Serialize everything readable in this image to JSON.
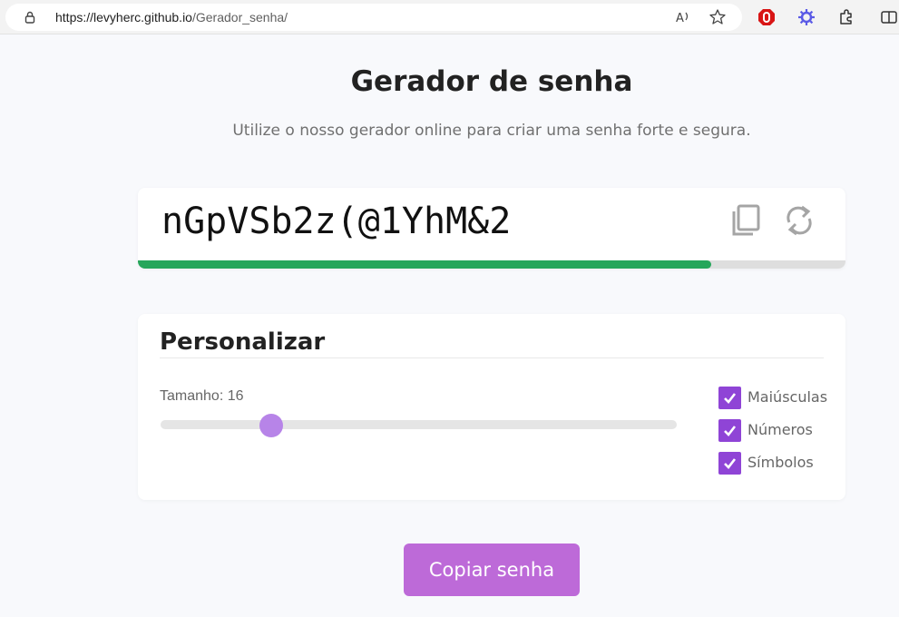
{
  "browser": {
    "url_host": "https://levyherc.github.io",
    "url_path": "/Gerador_senha/"
  },
  "page": {
    "title": "Gerador de senha",
    "subtitle": "Utilize o nosso gerador online para criar uma senha forte e segura."
  },
  "password": {
    "value": "nGpVSb2z(@1YhM&2",
    "strength_fraction": 0.81
  },
  "customize": {
    "title": "Personalizar",
    "size_label": "Tamanho: 16",
    "slider_fraction": 0.215,
    "options": [
      {
        "label": "Maiúsculas",
        "checked": true
      },
      {
        "label": "Números",
        "checked": true
      },
      {
        "label": "Símbolos",
        "checked": true
      }
    ]
  },
  "copy_button_label": "Copiar senha",
  "colors": {
    "strength_bar": "#26a65b",
    "accent": "#8f44d6",
    "button": "#bd6ad8"
  }
}
